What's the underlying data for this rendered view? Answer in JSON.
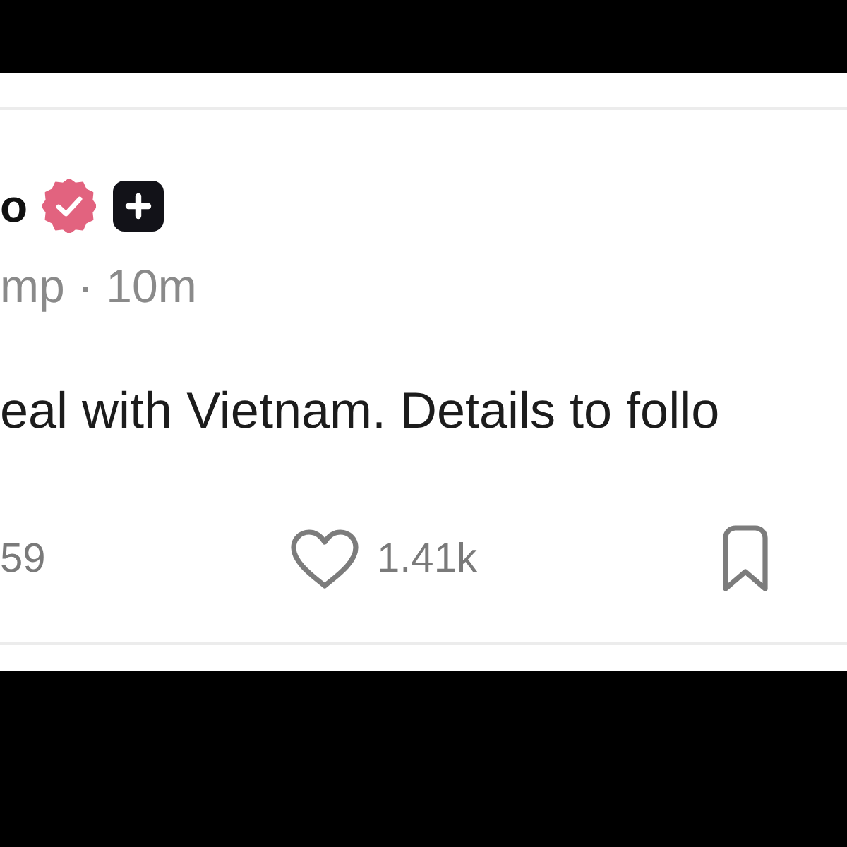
{
  "post": {
    "author": {
      "name": "o",
      "verified": true
    },
    "meta": "mp · 10m",
    "text": "eal with Vietnam. Details to follo",
    "actions": [
      {
        "kind": "reply",
        "count": "59"
      },
      {
        "kind": "like",
        "count": "1.41k"
      },
      {
        "kind": "bookmark"
      }
    ]
  }
}
